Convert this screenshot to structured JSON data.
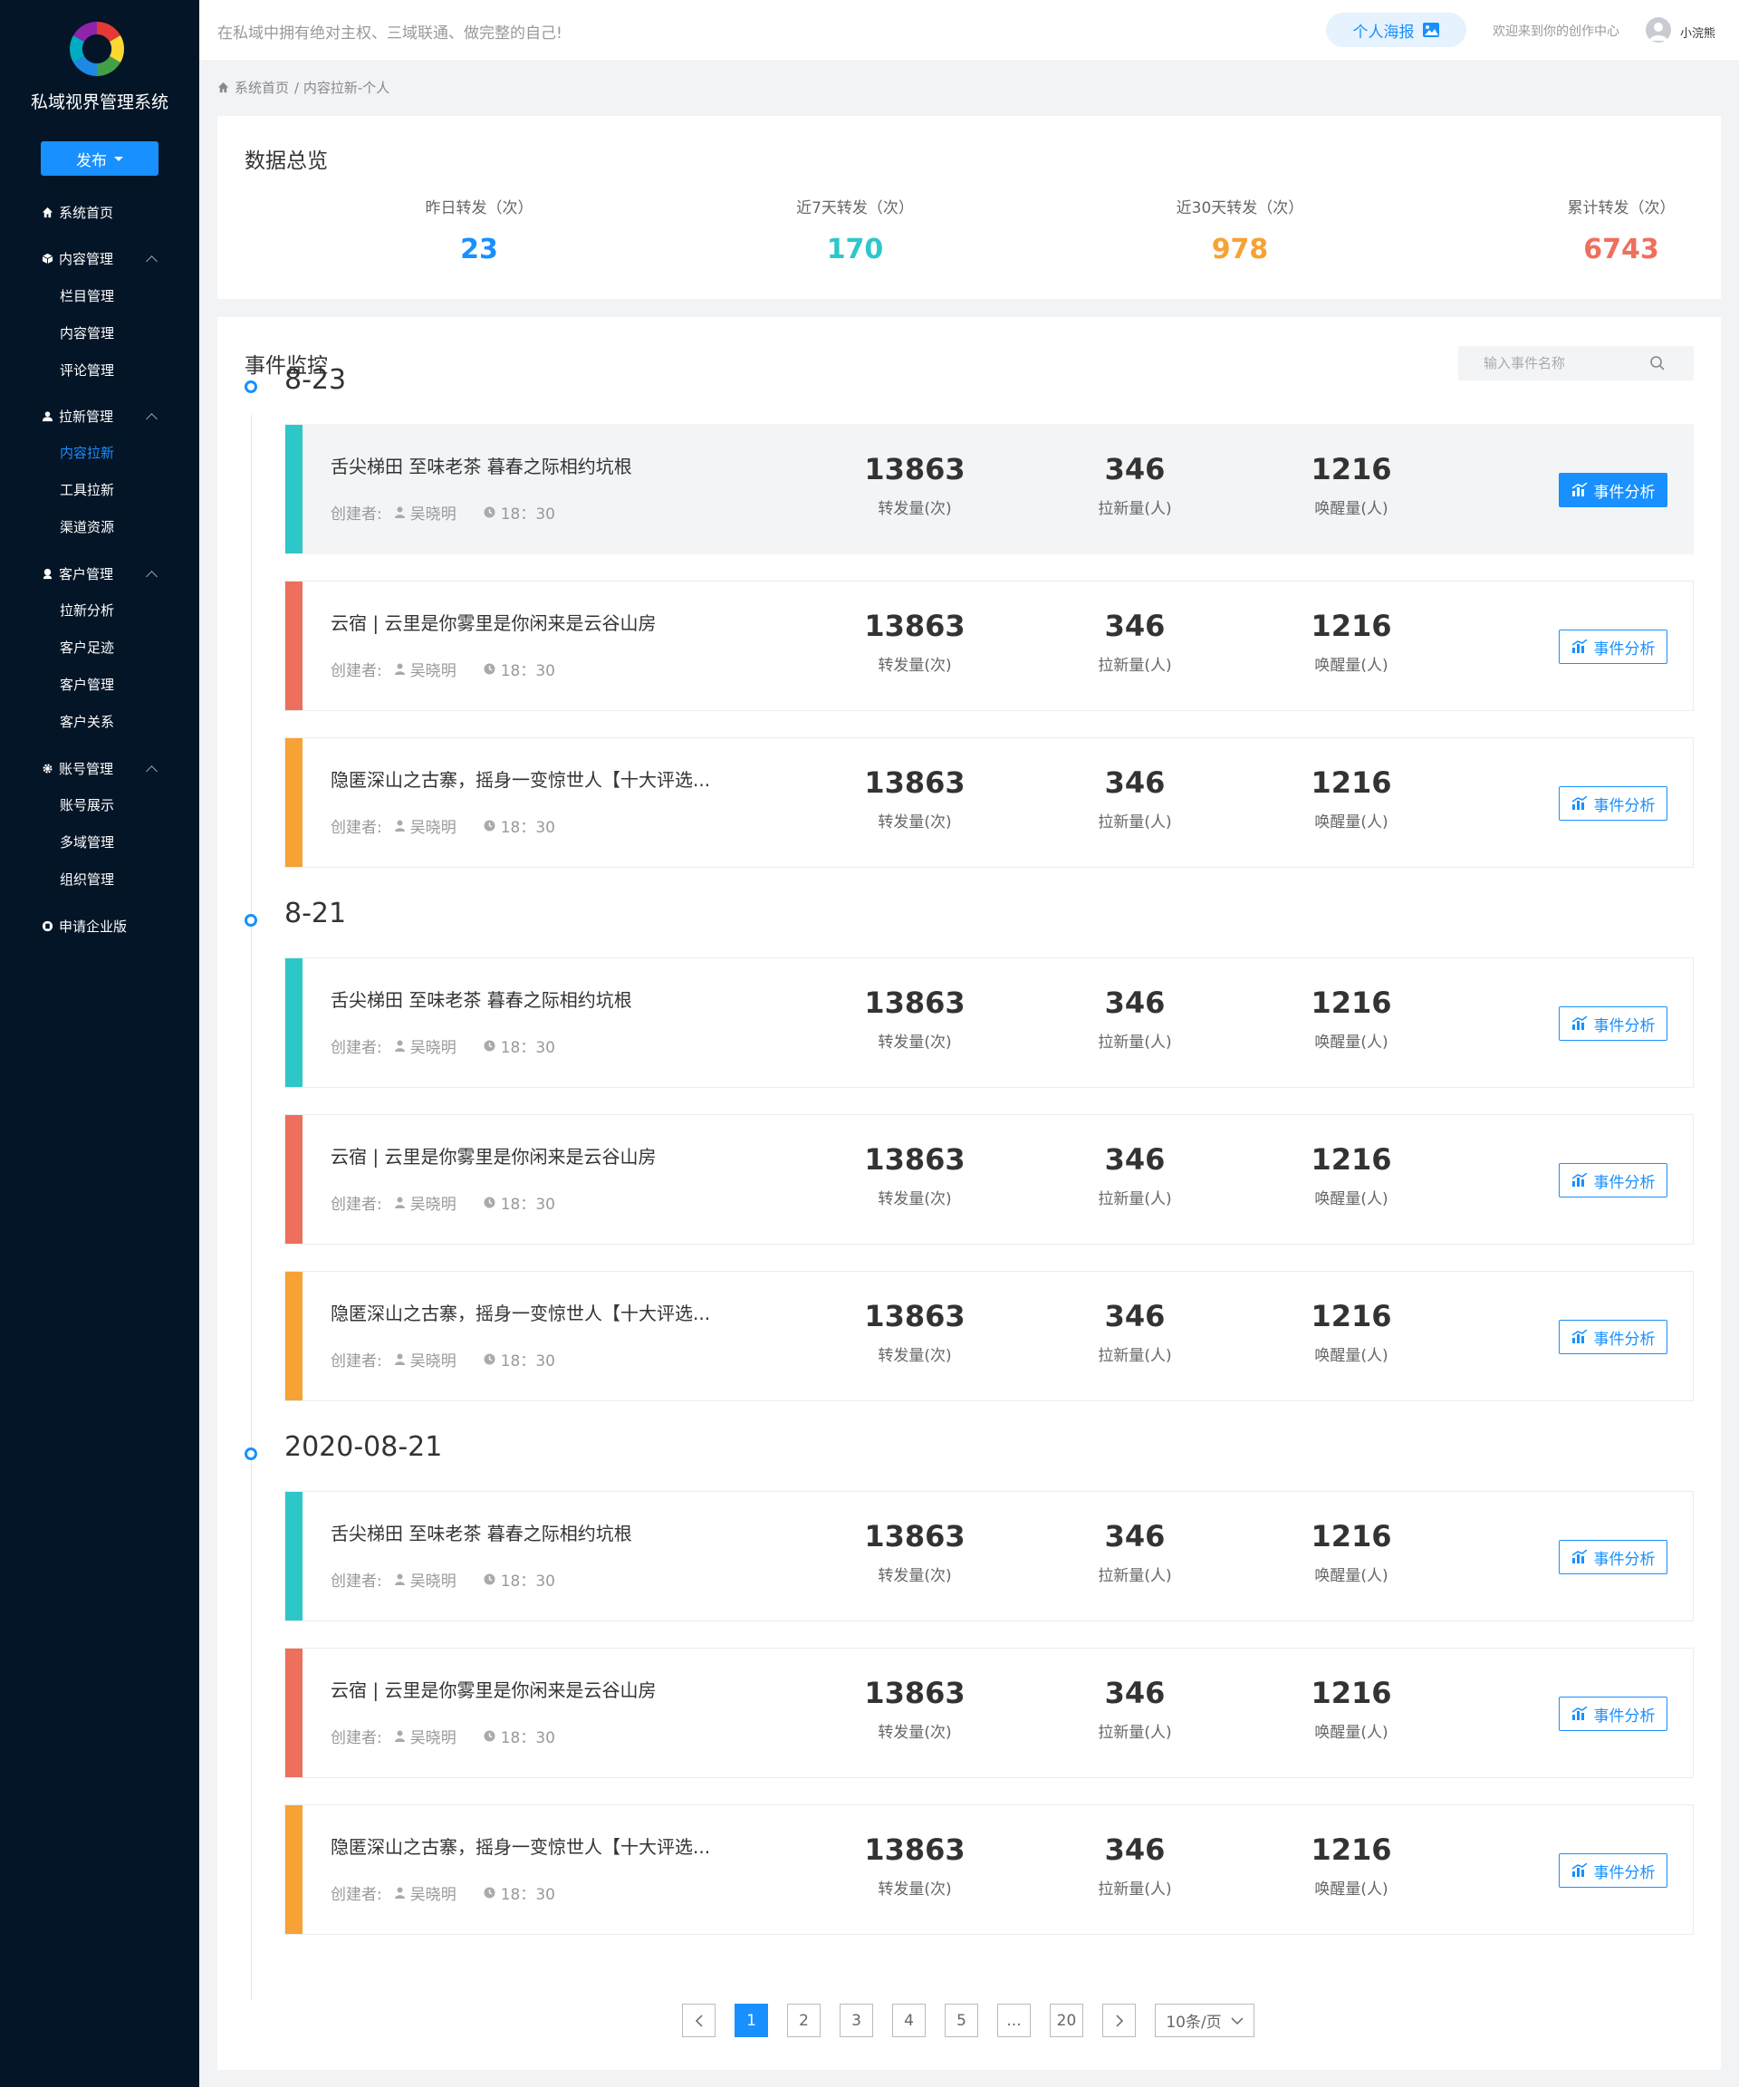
{
  "sidebar": {
    "system_name": "私域视界管理系统",
    "publish_label": "发布",
    "nav": {
      "home": "系统首页",
      "content": "内容管理",
      "content_items": [
        "栏目管理",
        "内容管理",
        "评论管理"
      ],
      "acquisition": "拉新管理",
      "acquisition_items": [
        "内容拉新",
        "工具拉新",
        "渠道资源"
      ],
      "customer": "客户管理",
      "customer_items": [
        "拉新分析",
        "客户足迹",
        "客户管理",
        "客户关系"
      ],
      "account": "账号管理",
      "account_items": [
        "账号展示",
        "多域管理",
        "组织管理"
      ],
      "enterprise": "申请企业版"
    },
    "active_item": "内容拉新"
  },
  "header": {
    "slogan": "在私域中拥有绝对主权、三域联通、做完整的自己!",
    "poster_label": "个人海报",
    "welcome": "欢迎来到你的创作中心",
    "username": "小浣熊"
  },
  "breadcrumb": [
    "系统首页",
    "/ 内容拉新-个人"
  ],
  "overview": {
    "title": "数据总览",
    "stats": [
      {
        "label": "昨日转发（次）",
        "value": "23",
        "color": "#1890ff"
      },
      {
        "label": "近7天转发（次）",
        "value": "170",
        "color": "#2ec7c9"
      },
      {
        "label": "近30天转发（次）",
        "value": "978",
        "color": "#f7a234"
      },
      {
        "label": "累计转发（次）",
        "value": "6743",
        "color": "#ee6f5c"
      }
    ]
  },
  "events": {
    "title": "事件监控",
    "search_placeholder": "输入事件名称",
    "metric_labels": [
      "转发量(次)",
      "拉新量(人)",
      "唤醒量(人)"
    ],
    "creator_label": "创建者:",
    "analyze_label": "事件分析",
    "groups": [
      {
        "date": "8-23",
        "items": [
          {
            "title": "舌尖梯田 至味老茶  暮春之际相约坑根",
            "creator": "吴晓明",
            "time": "18：30",
            "forward": "13863",
            "new": "346",
            "wake": "1216",
            "color": "#2ec7c9"
          },
          {
            "title": "云宿 | 云里是你雾里是你闲来是云谷山房",
            "creator": "吴晓明",
            "time": "18：30",
            "forward": "13863",
            "new": "346",
            "wake": "1216",
            "color": "#ee6f5c"
          },
          {
            "title": "隐匿深山之古寨，摇身一变惊世人【十大评选...",
            "creator": "吴晓明",
            "time": "18：30",
            "forward": "13863",
            "new": "346",
            "wake": "1216",
            "color": "#f7a234"
          }
        ]
      },
      {
        "date": "8-21",
        "items": [
          {
            "title": "舌尖梯田 至味老茶  暮春之际相约坑根",
            "creator": "吴晓明",
            "time": "18：30",
            "forward": "13863",
            "new": "346",
            "wake": "1216",
            "color": "#2ec7c9"
          },
          {
            "title": "云宿 | 云里是你雾里是你闲来是云谷山房",
            "creator": "吴晓明",
            "time": "18：30",
            "forward": "13863",
            "new": "346",
            "wake": "1216",
            "color": "#ee6f5c"
          },
          {
            "title": "隐匿深山之古寨，摇身一变惊世人【十大评选...",
            "creator": "吴晓明",
            "time": "18：30",
            "forward": "13863",
            "new": "346",
            "wake": "1216",
            "color": "#f7a234"
          }
        ]
      },
      {
        "date": "2020-08-21",
        "items": [
          {
            "title": "舌尖梯田 至味老茶  暮春之际相约坑根",
            "creator": "吴晓明",
            "time": "18：30",
            "forward": "13863",
            "new": "346",
            "wake": "1216",
            "color": "#2ec7c9"
          },
          {
            "title": "云宿 | 云里是你雾里是你闲来是云谷山房",
            "creator": "吴晓明",
            "time": "18：30",
            "forward": "13863",
            "new": "346",
            "wake": "1216",
            "color": "#ee6f5c"
          },
          {
            "title": "隐匿深山之古寨，摇身一变惊世人【十大评选...",
            "creator": "吴晓明",
            "time": "18：30",
            "forward": "13863",
            "new": "346",
            "wake": "1216",
            "color": "#f7a234"
          }
        ]
      }
    ]
  },
  "pagination": {
    "pages": [
      "1",
      "2",
      "3",
      "4",
      "5",
      "...",
      "20"
    ],
    "current": "1",
    "page_size": "10条/页"
  },
  "icons": {
    "home": "home-icon",
    "content": "cube-icon",
    "acquisition": "users-icon",
    "customer": "customer-icon",
    "account": "gear-icon",
    "enterprise": "building-icon",
    "search": "search-icon",
    "analyze": "bar-chart-icon",
    "poster": "image-icon"
  }
}
